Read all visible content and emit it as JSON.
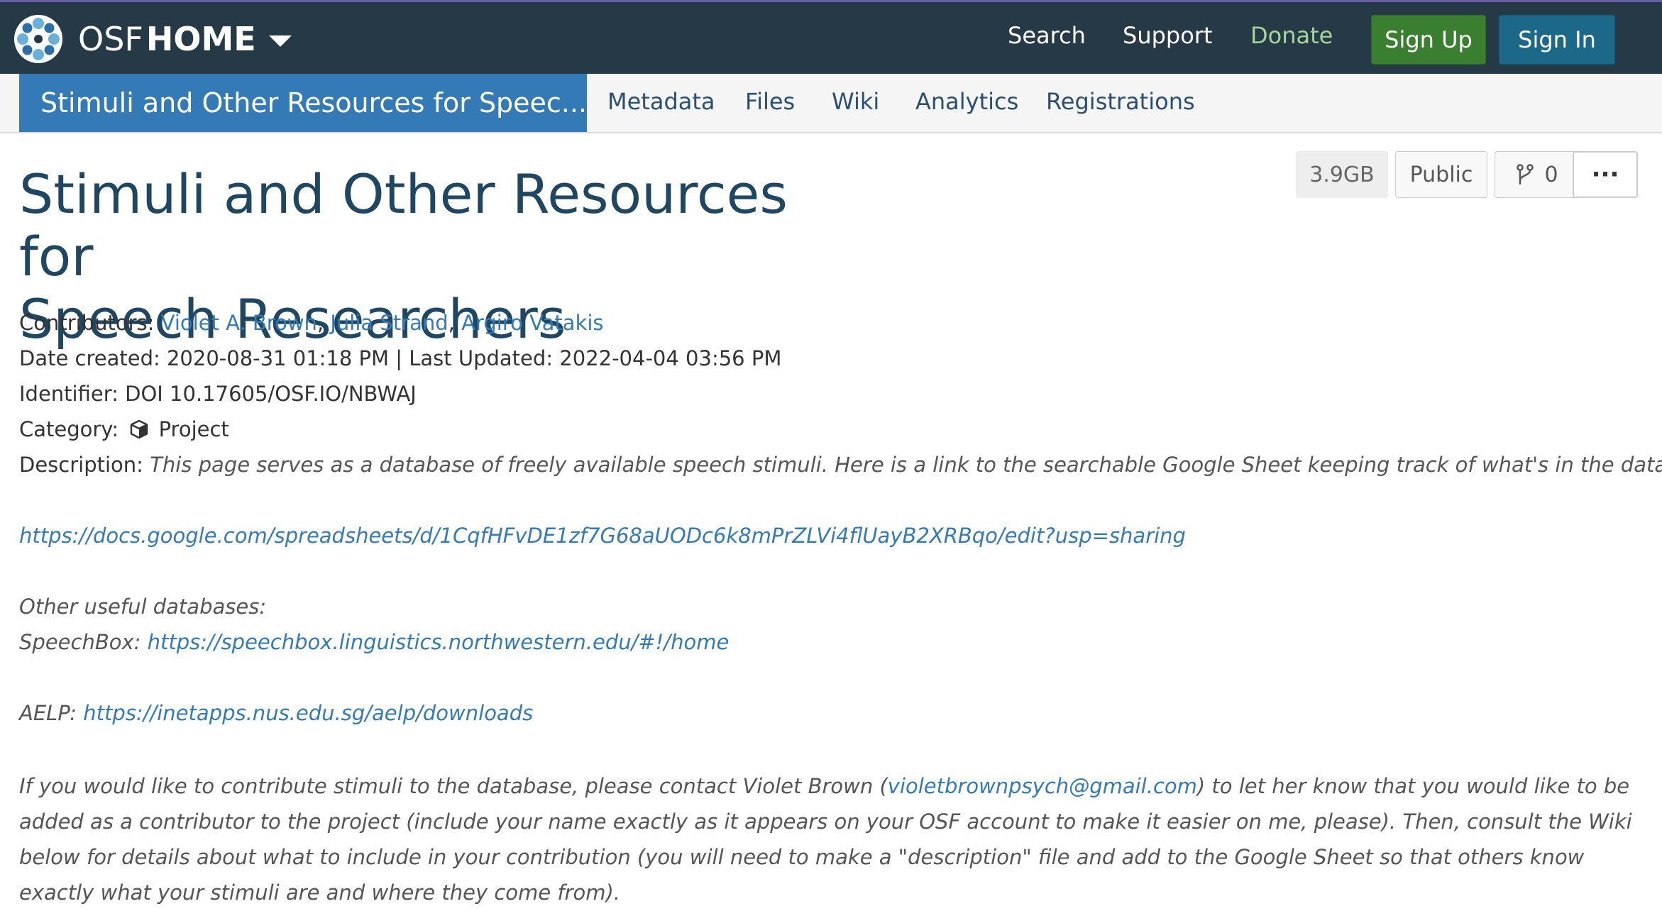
{
  "navbar": {
    "brand_osf": "OSF",
    "brand_home": "HOME",
    "links": {
      "search": "Search",
      "support": "Support",
      "donate": "Donate"
    },
    "sign_up": "Sign Up",
    "sign_in": "Sign In"
  },
  "subnav": {
    "project_title": "Stimuli and Other Resources for Speec...",
    "tabs": [
      "Metadata",
      "Files",
      "Wiki",
      "Analytics",
      "Registrations"
    ]
  },
  "actions": {
    "size": "3.9GB",
    "visibility": "Public",
    "fork_count": "0",
    "more": "···"
  },
  "project": {
    "title_line1": "Stimuli and Other Resources for",
    "title_line2": "Speech Researchers",
    "contributors_label": "Contributors:",
    "contributors": [
      "Violet A. Brown",
      "Julia Strand",
      "Argiro Vatakis"
    ],
    "separator": ", ",
    "dates": "Date created: 2020-08-31 01:18 PM | Last Updated: 2022-04-04 03:56 PM",
    "identifier": "Identifier: DOI 10.17605/OSF.IO/NBWAJ",
    "category_label": "Category:",
    "category": "Project",
    "description_label": "Description:",
    "description_intro": "This page serves as a database of freely available speech stimuli. Here is a link to the searchable Google Sheet keeping track of what's in the database:",
    "sheet_url": "https://docs.google.com/spreadsheets/d/1CqfHFvDE1zf7G68aUODc6k8mPrZLVi4flUayB2XRBqo/edit?usp=sharing",
    "other_db_label": "Other useful databases:",
    "speechbox_label": "SpeechBox: ",
    "speechbox_url": "https://speechbox.linguistics.northwestern.edu/#!/home",
    "aelp_label": "AELP: ",
    "aelp_url": "https://inetapps.nus.edu.sg/aelp/downloads",
    "contribute_text_before": "If you would like to contribute stimuli to the database, please contact Violet Brown (",
    "contact_email": "violetbrownpsych@gmail.com",
    "contribute_text_after": ") to let her know that you would like to be added as a contributor to the project (include your name exactly as it appears on your OSF account to make it easier on me, please). Then, consult the Wiki below for details about what to include in your contribution (you will need to make a \"description\" file and add to the Google Sheet so that others know exactly what your stimuli are and where they come from)."
  },
  "colors": {
    "navbar_bg": "#263947",
    "donate": "#a6d49a",
    "signup": "#3a7e2f",
    "signin": "#1b6888",
    "subnav_title_bg": "#337ab7",
    "title_color": "#204762",
    "link": "#337ab7"
  },
  "icons": {
    "brand": "osf-logo-icon",
    "caret": "caret-down-icon",
    "fork": "fork-icon",
    "category": "cube-icon",
    "more": "ellipsis-icon"
  }
}
